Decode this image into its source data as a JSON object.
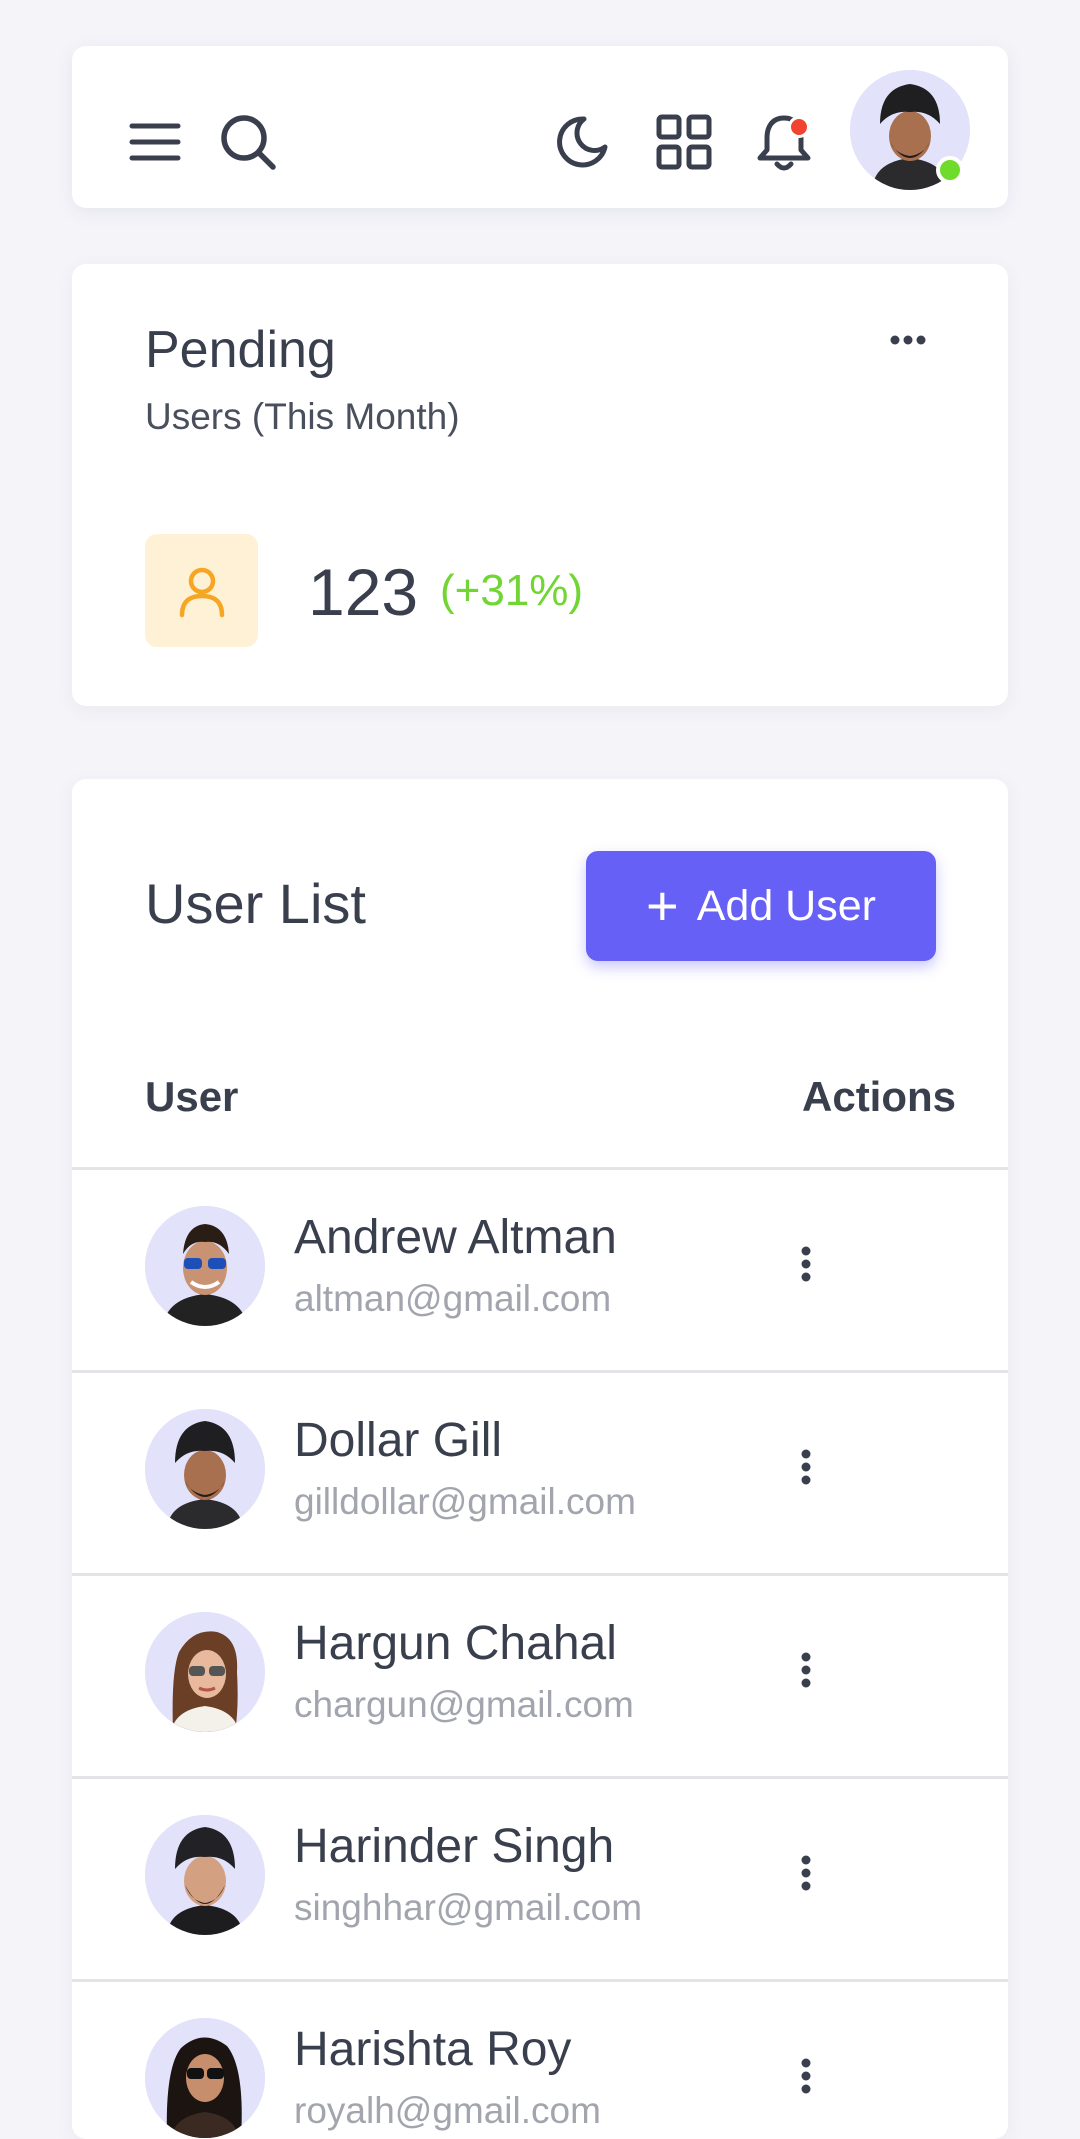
{
  "topbar": {
    "icons": [
      "menu-icon",
      "search-icon",
      "moon-icon",
      "grid-icon",
      "bell-icon"
    ],
    "notification_dot_color": "#f1432f",
    "online_status_color": "#6fdb2a"
  },
  "pending_card": {
    "title": "Pending",
    "subtitle": "Users (This Month)",
    "value": "123",
    "change": "(+31%)",
    "change_color": "#71d534",
    "icon": "user-icon",
    "icon_color": "#f5a623"
  },
  "user_list": {
    "title": "User List",
    "add_button_label": "Add User",
    "accent_color": "#6660f6",
    "columns": {
      "user": "User",
      "actions": "Actions"
    },
    "rows": [
      {
        "name": "Andrew Altman",
        "email": "altman@gmail.com"
      },
      {
        "name": "Dollar Gill",
        "email": "gilldollar@gmail.com"
      },
      {
        "name": "Hargun Chahal",
        "email": "chargun@gmail.com"
      },
      {
        "name": "Harinder Singh",
        "email": "singhhar@gmail.com"
      },
      {
        "name": "Harishta Roy",
        "email": "royalh@gmail.com"
      }
    ]
  }
}
